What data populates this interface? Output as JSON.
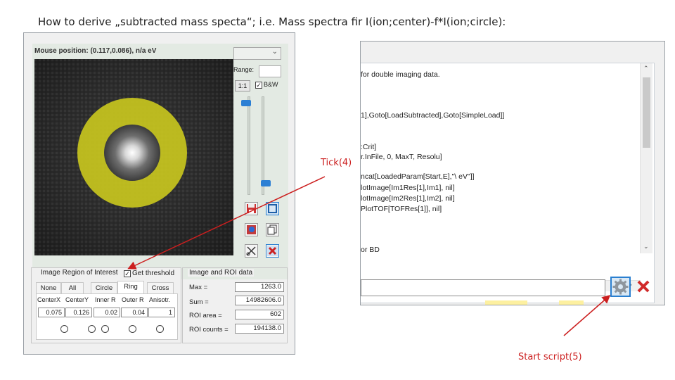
{
  "title": "How to derive „subtracted mass specta“; i.e. Mass spectra fir I(ion;center)-f*I(ion;circle):",
  "left_panel": {
    "mouse_position": "Mouse position: (0.117,0.086), n/a eV",
    "range_label": "Range:",
    "range_value": "",
    "scale_button": "1:1",
    "bw_label": "B&W",
    "bw_checked": true,
    "roi_group_title": "Image Region of Interest",
    "get_threshold_label": "Get threshold",
    "get_threshold_checked": true,
    "tabs": [
      "None",
      "All",
      "Circle",
      "Ring",
      "Cross"
    ],
    "active_tab": "Ring",
    "columns": [
      "CenterX",
      "CenterY",
      "Inner R",
      "Outer R",
      "Anisotr."
    ],
    "values": [
      "0.075",
      "0.126",
      "0.02",
      "0.04",
      "1"
    ],
    "data_group_title": "Image and ROI data",
    "stats": [
      {
        "label": "Max =",
        "value": "1263.0"
      },
      {
        "label": "Sum =",
        "value": "14982606.0"
      },
      {
        "label": "ROI area =",
        "value": "602"
      },
      {
        "label": "ROI counts =",
        "value": "194138.0"
      }
    ],
    "slider_top_level": 0.97,
    "slider_bottom_level": 0.1
  },
  "script_panel": {
    "lines": [
      "for double imaging data.",
      "1],Goto[LoadSubtracted],Goto[SimpleLoad]]",
      ":Crit]",
      "r.InFile, 0, MaxT, Resolu]",
      "ncat[LoadedParam[Start,E],\"\\ eV\"]]",
      "lotImage[Im1Res[1],Im1], nil]",
      "lotImage[Im2Res[1],Im2], nil]",
      "PlotTOF[TOFRes[1]], nil]",
      "or BD"
    ],
    "command_value": ""
  },
  "annotations": {
    "tick": "Tick(4)",
    "start": "Start script(5)"
  },
  "colors": {
    "annotation_red": "#cc1f1f",
    "ring_yellow": "#c8c51e",
    "accent_blue": "#2a7fd0"
  }
}
